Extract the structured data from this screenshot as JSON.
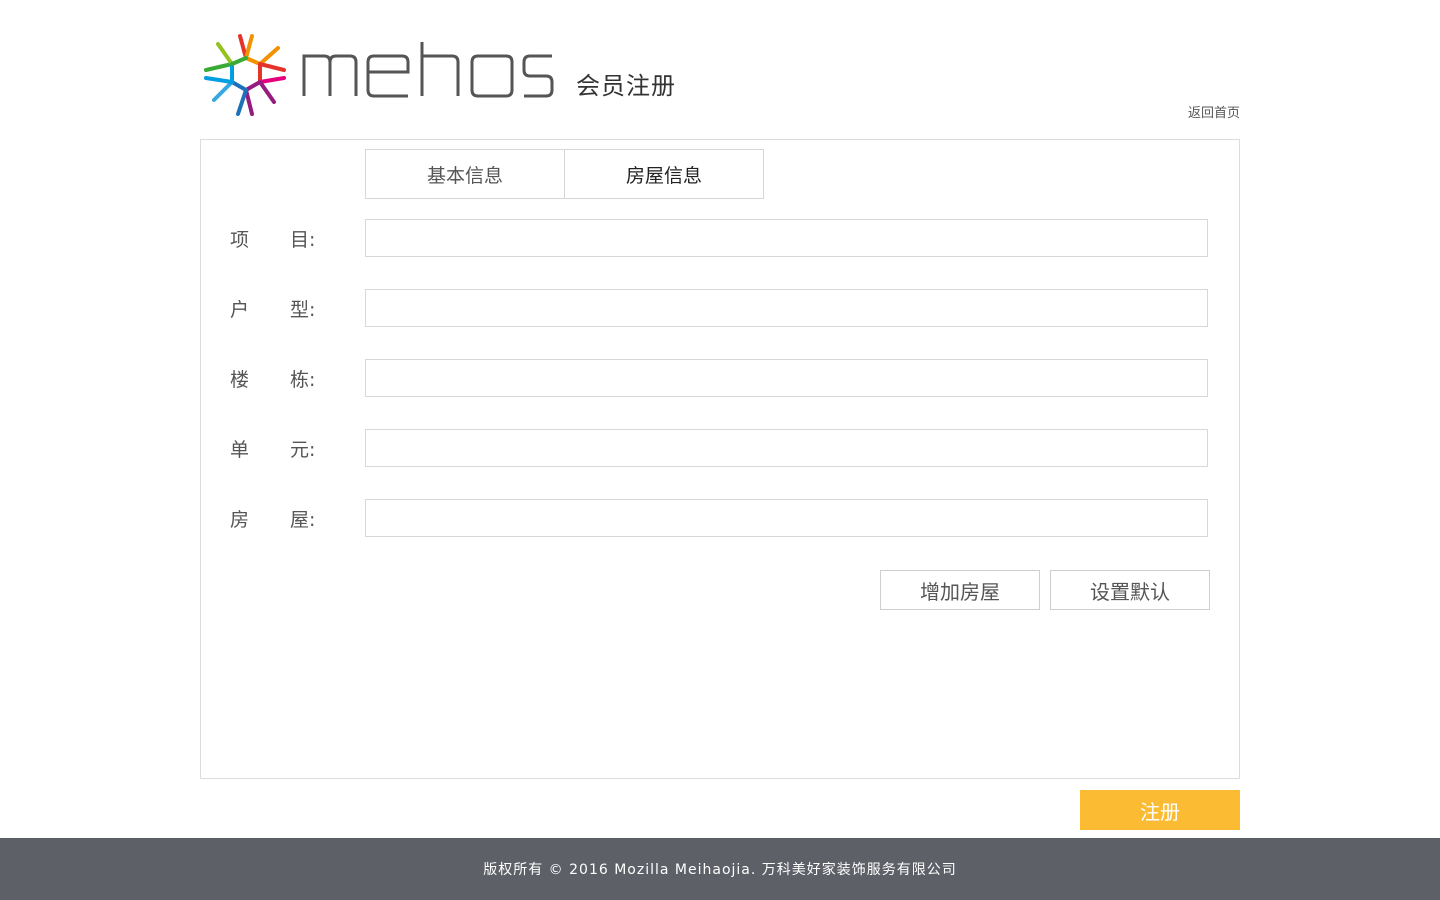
{
  "header": {
    "logo_text": "mehos",
    "page_title": "会员注册",
    "home_link": "返回首页"
  },
  "tabs": [
    {
      "label": "基本信息",
      "active": false
    },
    {
      "label": "房屋信息",
      "active": true
    }
  ],
  "form": {
    "fields": [
      {
        "label_first": "项",
        "label_last": "目:",
        "value": ""
      },
      {
        "label_first": "户",
        "label_last": "型:",
        "value": ""
      },
      {
        "label_first": "楼",
        "label_last": "栋:",
        "value": ""
      },
      {
        "label_first": "单",
        "label_last": "元:",
        "value": ""
      },
      {
        "label_first": "房",
        "label_last": "屋:",
        "value": ""
      }
    ],
    "add_house_label": "增加房屋",
    "set_default_label": "设置默认"
  },
  "register_label": "注册",
  "footer": {
    "copyright": "版权所有 © 2016 Mozilla Meihaojia. 万科美好家装饰服务有限公司"
  },
  "colors": {
    "accent": "#fbbb33",
    "footer_bg": "#5e6067",
    "border": "#d8d8d8"
  }
}
